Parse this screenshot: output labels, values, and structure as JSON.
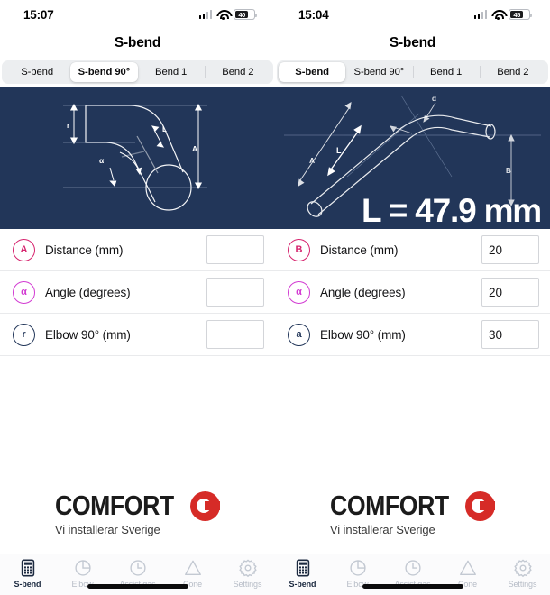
{
  "left": {
    "status": {
      "time": "15:07",
      "battery": "40"
    },
    "nav_title": "S-bend",
    "segments": [
      {
        "label": "S-bend",
        "selected": false
      },
      {
        "label": "S-bend 90°",
        "selected": true
      },
      {
        "label": "Bend 1",
        "selected": false
      },
      {
        "label": "Bend 2",
        "selected": false
      }
    ],
    "diagram": {
      "labels": {
        "r": "r",
        "L": "L",
        "alpha": "α",
        "A": "A"
      },
      "result": ""
    },
    "rows": [
      {
        "badge": "A",
        "badge_color": "#d6246e",
        "label": "Distance (mm)",
        "value": ""
      },
      {
        "badge": "α",
        "badge_color": "#d23bd2",
        "label": "Angle (degrees)",
        "value": ""
      },
      {
        "badge": "r",
        "badge_color": "#223659",
        "label": "Elbow 90° (mm)",
        "value": ""
      }
    ],
    "logo": {
      "word": "COMFORT",
      "tagline": "Vi installerar Sverige",
      "mark_color": "#d62b27"
    },
    "tabs": [
      {
        "label": "S-bend",
        "icon": "calculator-icon",
        "active": true
      },
      {
        "label": "Elbow",
        "icon": "pie-slice-icon",
        "active": false
      },
      {
        "label": "Assist gas",
        "icon": "clock-icon",
        "active": false
      },
      {
        "label": "Cone",
        "icon": "triangle-icon",
        "active": false
      },
      {
        "label": "Settings",
        "icon": "gear-icon",
        "active": false
      }
    ]
  },
  "right": {
    "status": {
      "time": "15:04",
      "battery": "45"
    },
    "nav_title": "S-bend",
    "segments": [
      {
        "label": "S-bend",
        "selected": true
      },
      {
        "label": "S-bend 90°",
        "selected": false
      },
      {
        "label": "Bend 1",
        "selected": false
      },
      {
        "label": "Bend 2",
        "selected": false
      }
    ],
    "diagram": {
      "labels": {
        "A": "A",
        "L": "L",
        "alpha": "α",
        "B": "B"
      },
      "result": "L = 47.9 mm"
    },
    "rows": [
      {
        "badge": "B",
        "badge_color": "#d6246e",
        "label": "Distance (mm)",
        "value": "20"
      },
      {
        "badge": "α",
        "badge_color": "#d23bd2",
        "label": "Angle (degrees)",
        "value": "20"
      },
      {
        "badge": "a",
        "badge_color": "#223659",
        "label": "Elbow 90° (mm)",
        "value": "30"
      }
    ],
    "logo": {
      "word": "COMFORT",
      "tagline": "Vi installerar Sverige",
      "mark_color": "#d62b27"
    },
    "tabs": [
      {
        "label": "S-bend",
        "icon": "calculator-icon",
        "active": true
      },
      {
        "label": "Elbow",
        "icon": "pie-slice-icon",
        "active": false
      },
      {
        "label": "Assist gas",
        "icon": "clock-icon",
        "active": false
      },
      {
        "label": "Cone",
        "icon": "triangle-icon",
        "active": false
      },
      {
        "label": "Settings",
        "icon": "gear-icon",
        "active": false
      }
    ]
  },
  "theme": {
    "diagram_bg": "#223659",
    "accent_pink": "#d6246e",
    "accent_magenta": "#d23bd2",
    "navy": "#223659"
  }
}
